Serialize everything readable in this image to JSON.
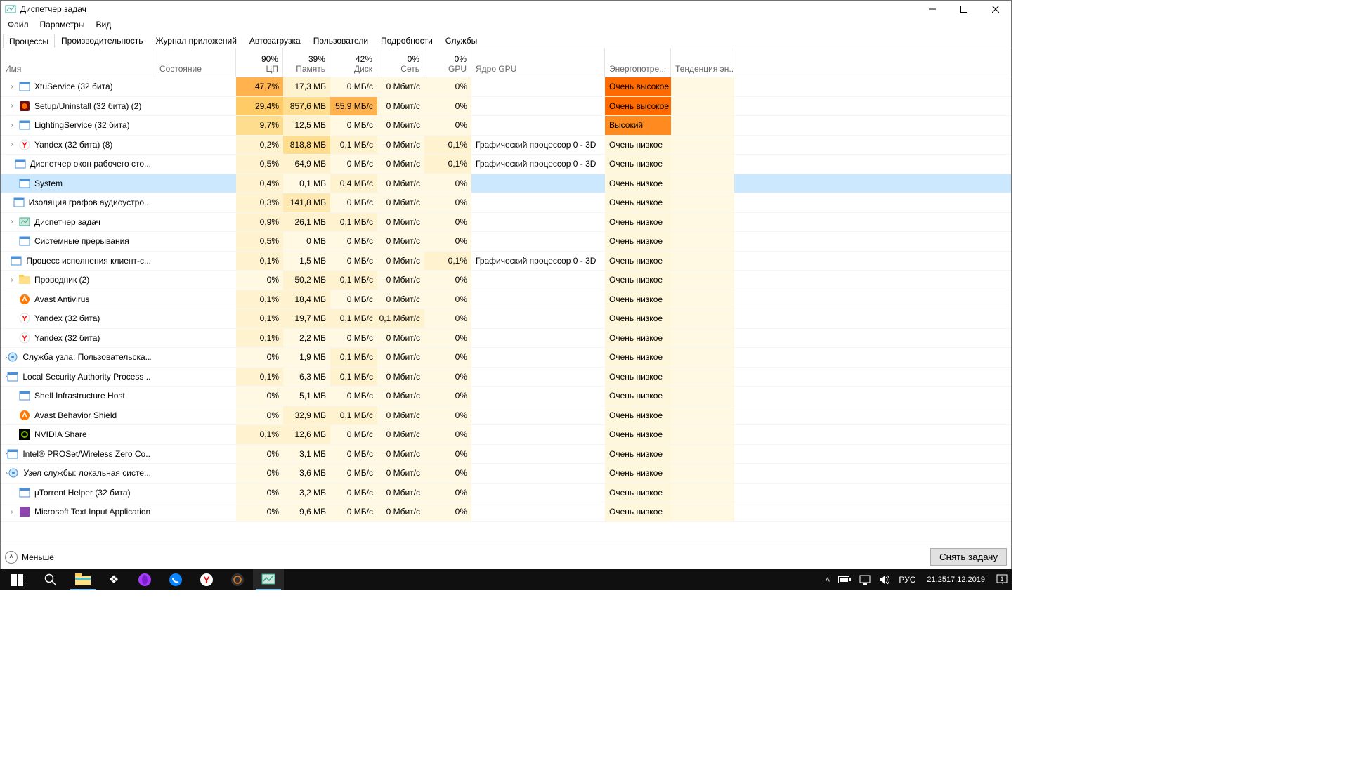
{
  "window": {
    "title": "Диспетчер задач",
    "min": "—",
    "max": "▢",
    "close": "✕"
  },
  "menu": {
    "items": [
      "Файл",
      "Параметры",
      "Вид"
    ]
  },
  "tabs": [
    "Процессы",
    "Производительность",
    "Журнал приложений",
    "Автозагрузка",
    "Пользователи",
    "Подробности",
    "Службы"
  ],
  "activeTab": 0,
  "headers": {
    "name": "Имя",
    "status": "Состояние",
    "cpu_pct": "90%",
    "cpu_label": "ЦП",
    "mem_pct": "39%",
    "mem_label": "Память",
    "disk_pct": "42%",
    "disk_label": "Диск",
    "net_pct": "0%",
    "net_label": "Сеть",
    "gpu_pct": "0%",
    "gpu_label": "GPU",
    "gpu_engine": "Ядро GPU",
    "power": "Энергопотре...",
    "trend": "Тенденция эн..."
  },
  "rows": [
    {
      "expand": true,
      "icon": "app-blue",
      "name": "XtuService (32 бита)",
      "cpu": "47,7%",
      "cpuH": 5,
      "mem": "17,3 МБ",
      "memH": 1,
      "disk": "0 МБ/с",
      "diskH": 0,
      "net": "0 Мбит/с",
      "netH": 0,
      "gpu": "0%",
      "gpuH": 0,
      "gpuEng": "",
      "power": "Очень высокое",
      "powerCls": "pvh"
    },
    {
      "expand": true,
      "icon": "setup-red",
      "name": "Setup/Uninstall (32 бита) (2)",
      "cpu": "29,4%",
      "cpuH": 4,
      "mem": "857,6 МБ",
      "memH": 3,
      "disk": "55,9 МБ/с",
      "diskH": 5,
      "net": "0 Мбит/с",
      "netH": 0,
      "gpu": "0%",
      "gpuH": 0,
      "gpuEng": "",
      "power": "Очень высокое",
      "powerCls": "pvh"
    },
    {
      "expand": true,
      "icon": "app-blue",
      "name": "LightingService (32 бита)",
      "cpu": "9,7%",
      "cpuH": 3,
      "mem": "12,5 МБ",
      "memH": 1,
      "disk": "0 МБ/с",
      "diskH": 0,
      "net": "0 Мбит/с",
      "netH": 0,
      "gpu": "0%",
      "gpuH": 0,
      "gpuEng": "",
      "power": "Высокий",
      "powerCls": "ph"
    },
    {
      "expand": true,
      "icon": "yandex",
      "name": "Yandex (32 бита) (8)",
      "cpu": "0,2%",
      "cpuH": 1,
      "mem": "818,8 МБ",
      "memH": 3,
      "disk": "0,1 МБ/с",
      "diskH": 1,
      "net": "0 Мбит/с",
      "netH": 0,
      "gpu": "0,1%",
      "gpuH": 1,
      "gpuEng": "Графический процессор 0 - 3D",
      "power": "Очень низкое",
      "powerCls": "pl"
    },
    {
      "expand": false,
      "icon": "app-blue",
      "name": "Диспетчер окон рабочего сто...",
      "cpu": "0,5%",
      "cpuH": 1,
      "mem": "64,9 МБ",
      "memH": 1,
      "disk": "0 МБ/с",
      "diskH": 0,
      "net": "0 Мбит/с",
      "netH": 0,
      "gpu": "0,1%",
      "gpuH": 1,
      "gpuEng": "Графический процессор 0 - 3D",
      "power": "Очень низкое",
      "powerCls": "pl"
    },
    {
      "expand": false,
      "icon": "app-blue",
      "name": "System",
      "cpu": "0,4%",
      "cpuH": 1,
      "mem": "0,1 МБ",
      "memH": 0,
      "disk": "0,4 МБ/с",
      "diskH": 1,
      "net": "0 Мбит/с",
      "netH": 0,
      "gpu": "0%",
      "gpuH": 0,
      "gpuEng": "",
      "power": "Очень низкое",
      "powerCls": "pl",
      "selected": true
    },
    {
      "expand": false,
      "icon": "app-blue",
      "name": "Изоляция графов аудиоустро...",
      "cpu": "0,3%",
      "cpuH": 1,
      "mem": "141,8 МБ",
      "memH": 2,
      "disk": "0 МБ/с",
      "diskH": 0,
      "net": "0 Мбит/с",
      "netH": 0,
      "gpu": "0%",
      "gpuH": 0,
      "gpuEng": "",
      "power": "Очень низкое",
      "powerCls": "pl"
    },
    {
      "expand": true,
      "icon": "taskmgr",
      "name": "Диспетчер задач",
      "cpu": "0,9%",
      "cpuH": 1,
      "mem": "26,1 МБ",
      "memH": 1,
      "disk": "0,1 МБ/с",
      "diskH": 1,
      "net": "0 Мбит/с",
      "netH": 0,
      "gpu": "0%",
      "gpuH": 0,
      "gpuEng": "",
      "power": "Очень низкое",
      "powerCls": "pl"
    },
    {
      "expand": false,
      "icon": "app-blue",
      "name": "Системные прерывания",
      "cpu": "0,5%",
      "cpuH": 1,
      "mem": "0 МБ",
      "memH": 0,
      "disk": "0 МБ/с",
      "diskH": 0,
      "net": "0 Мбит/с",
      "netH": 0,
      "gpu": "0%",
      "gpuH": 0,
      "gpuEng": "",
      "power": "Очень низкое",
      "powerCls": "pl"
    },
    {
      "expand": false,
      "icon": "app-blue",
      "name": "Процесс исполнения клиент-с...",
      "cpu": "0,1%",
      "cpuH": 1,
      "mem": "1,5 МБ",
      "memH": 0,
      "disk": "0 МБ/с",
      "diskH": 0,
      "net": "0 Мбит/с",
      "netH": 0,
      "gpu": "0,1%",
      "gpuH": 1,
      "gpuEng": "Графический процессор 0 - 3D",
      "power": "Очень низкое",
      "powerCls": "pl"
    },
    {
      "expand": true,
      "icon": "explorer",
      "name": "Проводник (2)",
      "cpu": "0%",
      "cpuH": 0,
      "mem": "50,2 МБ",
      "memH": 1,
      "disk": "0,1 МБ/с",
      "diskH": 1,
      "net": "0 Мбит/с",
      "netH": 0,
      "gpu": "0%",
      "gpuH": 0,
      "gpuEng": "",
      "power": "Очень низкое",
      "powerCls": "pl"
    },
    {
      "expand": false,
      "icon": "avast",
      "name": "Avast Antivirus",
      "cpu": "0,1%",
      "cpuH": 1,
      "mem": "18,4 МБ",
      "memH": 1,
      "disk": "0 МБ/с",
      "diskH": 0,
      "net": "0 Мбит/с",
      "netH": 0,
      "gpu": "0%",
      "gpuH": 0,
      "gpuEng": "",
      "power": "Очень низкое",
      "powerCls": "pl"
    },
    {
      "expand": false,
      "icon": "yandex",
      "name": "Yandex (32 бита)",
      "cpu": "0,1%",
      "cpuH": 1,
      "mem": "19,7 МБ",
      "memH": 1,
      "disk": "0,1 МБ/с",
      "diskH": 1,
      "net": "0,1 Мбит/с",
      "netH": 1,
      "gpu": "0%",
      "gpuH": 0,
      "gpuEng": "",
      "power": "Очень низкое",
      "powerCls": "pl"
    },
    {
      "expand": false,
      "icon": "yandex",
      "name": "Yandex (32 бита)",
      "cpu": "0,1%",
      "cpuH": 1,
      "mem": "2,2 МБ",
      "memH": 0,
      "disk": "0 МБ/с",
      "diskH": 0,
      "net": "0 Мбит/с",
      "netH": 0,
      "gpu": "0%",
      "gpuH": 0,
      "gpuEng": "",
      "power": "Очень низкое",
      "powerCls": "pl"
    },
    {
      "expand": true,
      "icon": "gear-blue",
      "name": "Служба узла: Пользовательска...",
      "cpu": "0%",
      "cpuH": 0,
      "mem": "1,9 МБ",
      "memH": 0,
      "disk": "0,1 МБ/с",
      "diskH": 1,
      "net": "0 Мбит/с",
      "netH": 0,
      "gpu": "0%",
      "gpuH": 0,
      "gpuEng": "",
      "power": "Очень низкое",
      "powerCls": "pl"
    },
    {
      "expand": true,
      "icon": "app-blue",
      "name": "Local Security Authority Process ...",
      "cpu": "0,1%",
      "cpuH": 1,
      "mem": "6,3 МБ",
      "memH": 0,
      "disk": "0,1 МБ/с",
      "diskH": 1,
      "net": "0 Мбит/с",
      "netH": 0,
      "gpu": "0%",
      "gpuH": 0,
      "gpuEng": "",
      "power": "Очень низкое",
      "powerCls": "pl"
    },
    {
      "expand": false,
      "icon": "app-blue",
      "name": "Shell Infrastructure Host",
      "cpu": "0%",
      "cpuH": 0,
      "mem": "5,1 МБ",
      "memH": 0,
      "disk": "0 МБ/с",
      "diskH": 0,
      "net": "0 Мбит/с",
      "netH": 0,
      "gpu": "0%",
      "gpuH": 0,
      "gpuEng": "",
      "power": "Очень низкое",
      "powerCls": "pl"
    },
    {
      "expand": false,
      "icon": "avast",
      "name": "Avast Behavior Shield",
      "cpu": "0%",
      "cpuH": 0,
      "mem": "32,9 МБ",
      "memH": 1,
      "disk": "0,1 МБ/с",
      "diskH": 1,
      "net": "0 Мбит/с",
      "netH": 0,
      "gpu": "0%",
      "gpuH": 0,
      "gpuEng": "",
      "power": "Очень низкое",
      "powerCls": "pl"
    },
    {
      "expand": false,
      "icon": "nvidia",
      "name": "NVIDIA Share",
      "cpu": "0,1%",
      "cpuH": 1,
      "mem": "12,6 МБ",
      "memH": 1,
      "disk": "0 МБ/с",
      "diskH": 0,
      "net": "0 Мбит/с",
      "netH": 0,
      "gpu": "0%",
      "gpuH": 0,
      "gpuEng": "",
      "power": "Очень низкое",
      "powerCls": "pl"
    },
    {
      "expand": true,
      "icon": "app-blue",
      "name": "Intel® PROSet/Wireless Zero Co...",
      "cpu": "0%",
      "cpuH": 0,
      "mem": "3,1 МБ",
      "memH": 0,
      "disk": "0 МБ/с",
      "diskH": 0,
      "net": "0 Мбит/с",
      "netH": 0,
      "gpu": "0%",
      "gpuH": 0,
      "gpuEng": "",
      "power": "Очень низкое",
      "powerCls": "pl"
    },
    {
      "expand": true,
      "icon": "gear-blue",
      "name": "Узел службы: локальная систе...",
      "cpu": "0%",
      "cpuH": 0,
      "mem": "3,6 МБ",
      "memH": 0,
      "disk": "0 МБ/с",
      "diskH": 0,
      "net": "0 Мбит/с",
      "netH": 0,
      "gpu": "0%",
      "gpuH": 0,
      "gpuEng": "",
      "power": "Очень низкое",
      "powerCls": "pl"
    },
    {
      "expand": false,
      "icon": "app-blue",
      "name": "µTorrent Helper (32 бита)",
      "cpu": "0%",
      "cpuH": 0,
      "mem": "3,2 МБ",
      "memH": 0,
      "disk": "0 МБ/с",
      "diskH": 0,
      "net": "0 Мбит/с",
      "netH": 0,
      "gpu": "0%",
      "gpuH": 0,
      "gpuEng": "",
      "power": "Очень низкое",
      "powerCls": "pl"
    },
    {
      "expand": true,
      "icon": "app-purple",
      "name": "Microsoft Text Input Application",
      "cpu": "0%",
      "cpuH": 0,
      "mem": "9,6 МБ",
      "memH": 0,
      "disk": "0 МБ/с",
      "diskH": 0,
      "net": "0 Мбит/с",
      "netH": 0,
      "gpu": "0%",
      "gpuH": 0,
      "gpuEng": "",
      "power": "Очень низкое",
      "powerCls": "pl"
    }
  ],
  "statusbar": {
    "fewer": "Меньше",
    "endtask": "Снять задачу"
  },
  "taskbar": {
    "lang": "РУС",
    "time": "21:25",
    "date": "17.12.2019"
  }
}
